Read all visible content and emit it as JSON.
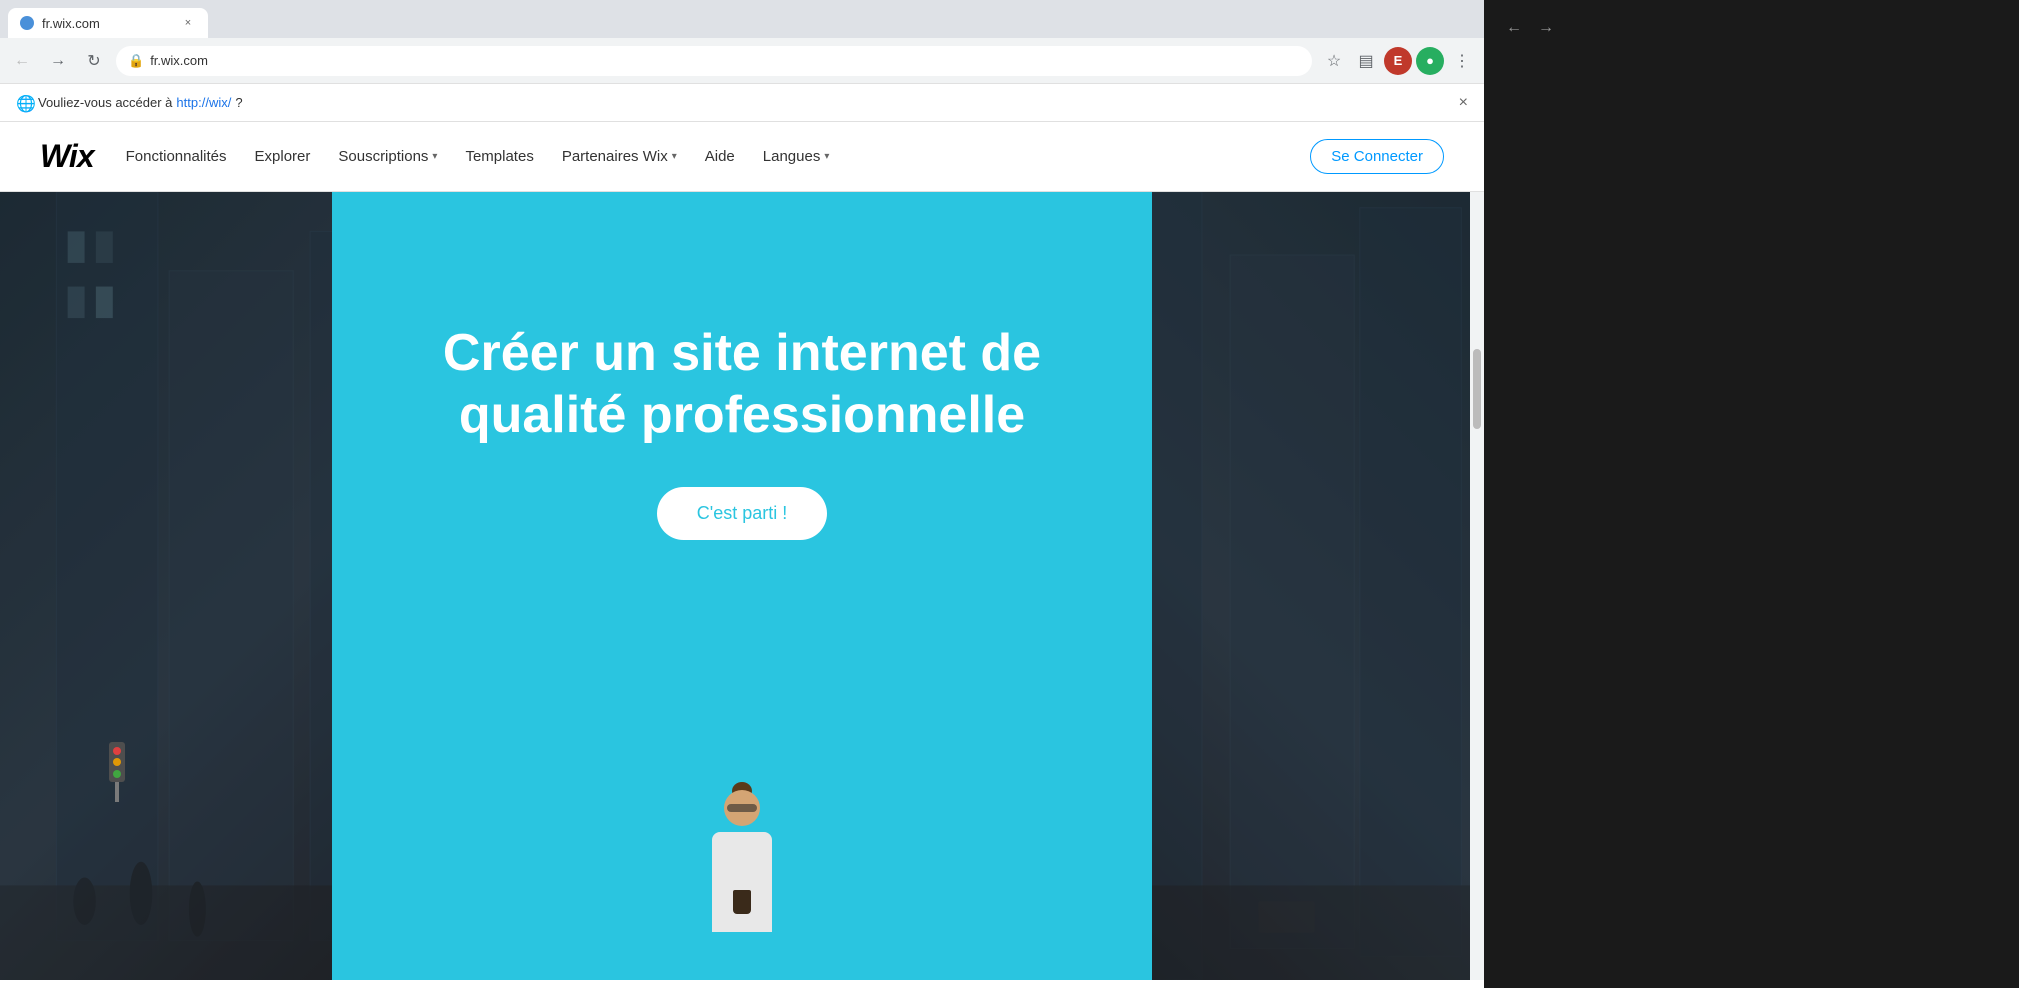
{
  "browser": {
    "address": "fr.wix.com",
    "tab_title": "fr.wix.com",
    "nav": {
      "back_disabled": true,
      "forward_disabled": false
    },
    "notification": {
      "text_before": "Vouliez-vous accéder à",
      "link_text": "http://wix/",
      "text_after": "?",
      "close_label": "×"
    },
    "profile_initial": "E",
    "ext_icon": "●"
  },
  "wix_nav": {
    "logo": "WiX",
    "links": [
      {
        "label": "Fonctionnalités",
        "has_dropdown": false
      },
      {
        "label": "Explorer",
        "has_dropdown": false
      },
      {
        "label": "Souscriptions",
        "has_dropdown": true
      },
      {
        "label": "Templates",
        "has_dropdown": false
      },
      {
        "label": "Partenaires Wix",
        "has_dropdown": true
      },
      {
        "label": "Aide",
        "has_dropdown": false
      },
      {
        "label": "Langues",
        "has_dropdown": true
      }
    ],
    "cta_button": "Se Connecter"
  },
  "hero": {
    "title_line1": "Créer un site internet de",
    "title_line2": "qualité professionnelle",
    "cta_button": "C'est parti !",
    "bg_color": "#2ac5e0"
  },
  "colors": {
    "hero_blue": "#2ac5e0",
    "nav_cta_color": "#0099ff",
    "body_bg": "#fff"
  }
}
